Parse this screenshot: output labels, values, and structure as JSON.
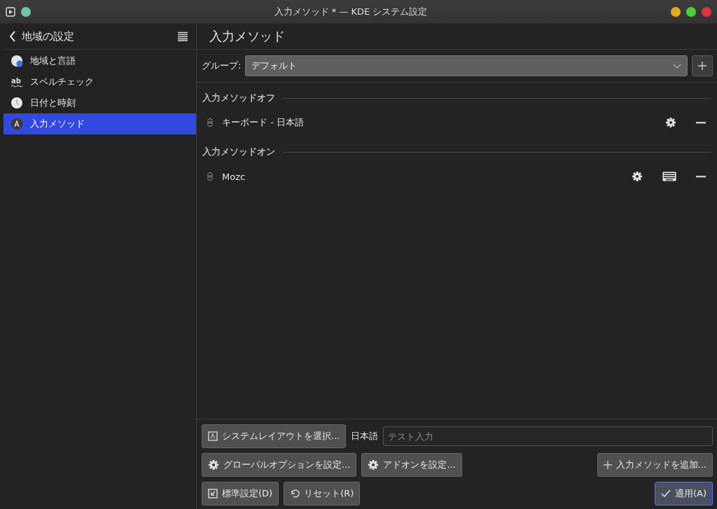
{
  "window": {
    "title": "入力メソッド * — KDE システム設定"
  },
  "sidebar": {
    "title": "地域の設定",
    "items": [
      {
        "label": "地域と言語",
        "kind": "globe",
        "selected": false
      },
      {
        "label": "スペルチェック",
        "kind": "spell",
        "icon_text": "ab",
        "selected": false
      },
      {
        "label": "日付と時刻",
        "kind": "clock",
        "selected": false
      },
      {
        "label": "入力メソッド",
        "kind": "input",
        "selected": true
      }
    ]
  },
  "page": {
    "title": "入力メソッド",
    "group": {
      "label": "グループ:",
      "value": "デフォルト"
    },
    "sections": [
      {
        "title": "入力メソッドオフ",
        "items": [
          {
            "name": "キーボード - 日本語",
            "layout_button": false
          }
        ]
      },
      {
        "title": "入力メソッドオン",
        "items": [
          {
            "name": "Mozc",
            "layout_button": true
          }
        ]
      }
    ]
  },
  "footer": {
    "layout_button": "システムレイアウトを選択...",
    "test_label": "日本語",
    "test_placeholder": "テスト入力",
    "row2": [
      {
        "label": "グローバルオプションを設定...",
        "kind": "gear"
      },
      {
        "label": "アドオンを設定...",
        "kind": "gear"
      },
      {
        "label": "入力メソッドを追加...",
        "kind": "plus"
      }
    ],
    "row3": [
      {
        "label": "標準設定(D)",
        "kind": "defaults"
      },
      {
        "label": "リセット(R)",
        "kind": "reset"
      },
      {
        "label": "適用(A)",
        "kind": "apply"
      }
    ]
  }
}
